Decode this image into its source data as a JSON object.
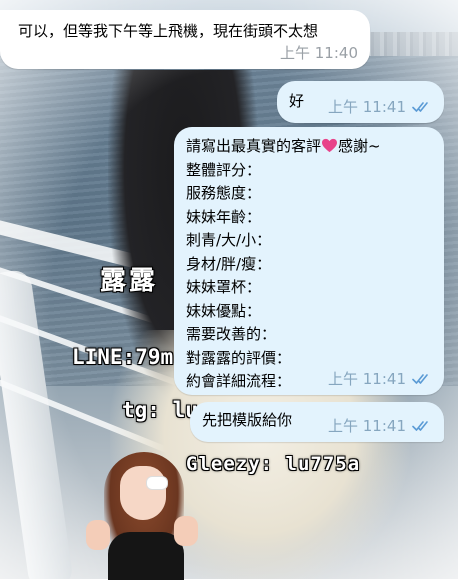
{
  "background": {
    "watermark_name": "露露",
    "watermark_line": "LINE:79m",
    "watermark_tg": "tg: lu",
    "watermark_gleezy": "Gleezy: lu775a"
  },
  "messages": [
    {
      "direction": "incoming",
      "text": "可以，但等我下午等上飛機，現在街頭不太想",
      "time": "上午 11:40"
    },
    {
      "direction": "outgoing",
      "text": "好",
      "time": "上午 11:41",
      "status": "read"
    },
    {
      "direction": "outgoing",
      "lines": [
        "請寫出最真實的客評",
        "感謝~",
        "整體評分：",
        "服務態度：",
        "妹妹年齡：",
        "刺青/大/小：",
        "身材/胖/瘦：",
        "妹妹罩杯：",
        "妹妹優點：",
        "需要改善的：",
        "對露露的評價：",
        "約會詳細流程："
      ],
      "time": "上午 11:41",
      "status": "read"
    },
    {
      "direction": "outgoing",
      "text": "先把模版給你",
      "time": "上午 11:41",
      "status": "read"
    }
  ],
  "colors": {
    "incoming_bubble": "#ffffff",
    "outgoing_bubble": "#e3f3fd",
    "time_out": "#86a6bf",
    "heart": "#e8438a"
  },
  "icons": {
    "read_status": "double-check-icon",
    "heart": "heart-icon"
  }
}
